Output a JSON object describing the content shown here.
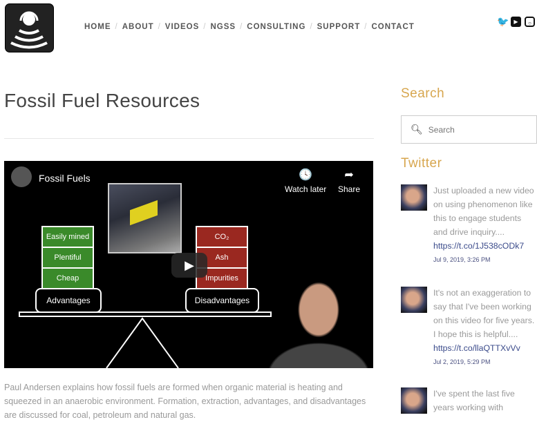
{
  "nav": [
    "HOME",
    "ABOUT",
    "VIDEOS",
    "NGSS",
    "CONSULTING",
    "SUPPORT",
    "CONTACT"
  ],
  "social": [
    "twitter-icon",
    "youtube-icon",
    "instagram-icon"
  ],
  "page_title": "Fossil Fuel Resources",
  "video": {
    "title": "Fossil Fuels",
    "watch_later": "Watch later",
    "share": "Share",
    "advantages": [
      "Easily mined",
      "Plentiful",
      "Cheap"
    ],
    "advantages_label": "Advantages",
    "disadvantages": [
      "CO₂",
      "Ash",
      "Impurities"
    ],
    "disadvantages_label": "Disadvantages"
  },
  "description": "Paul Andersen explains how fossil fuels are formed when organic material is heating and squeezed in an anaerobic environment. Formation, extraction, advantages, and disadvantages are discussed for coal, petroleum and natural gas.",
  "sidebar": {
    "search_heading": "Search",
    "search_placeholder": "Search",
    "twitter_heading": "Twitter",
    "tweets": [
      {
        "text": "Just uploaded a new video on using phenomenon like this to engage students and drive inquiry....",
        "link": "https://t.co/1J538cODk7",
        "date": "Jul 9, 2019, 3:26 PM"
      },
      {
        "text": "It's not an exaggeration to say that I've been working on this video for five years. I hope this is helpful....",
        "link": "https://t.co/llaQTTXvVv",
        "date": "Jul 2, 2019, 5:29 PM"
      },
      {
        "text": "I've spent the last five years working with"
      }
    ]
  },
  "colors": {
    "accent": "#d7a64e",
    "link": "#3a4a8a",
    "green": "#3a8a2a",
    "red": "#9a2820"
  }
}
